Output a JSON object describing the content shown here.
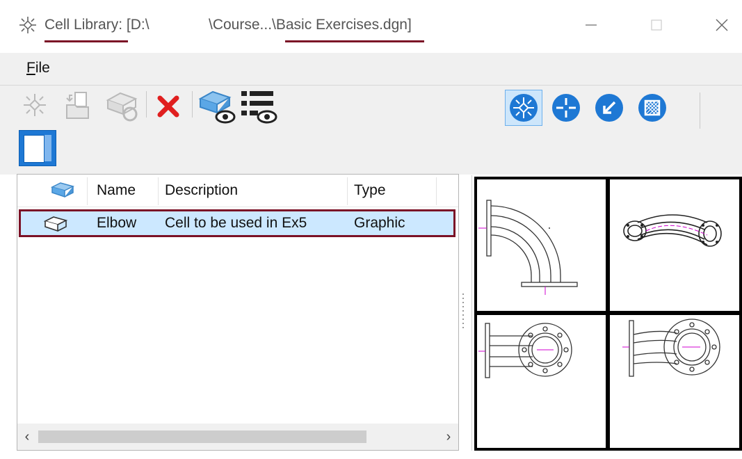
{
  "window": {
    "title_part1": "Cell Library: [D:\\",
    "title_part2": "\\Course...\\Basic Exercises.dgn]",
    "app_icon": "cell-library-icon",
    "controls": {
      "minimize": "minimize-icon",
      "maximize": "maximize-icon",
      "close": "close-icon"
    }
  },
  "menu": {
    "file_label_underlined": "F",
    "file_label_rest": "ile"
  },
  "toolbar": {
    "left_tools": [
      "create-cell-icon",
      "import-cell-icon",
      "update-library-icon",
      "delete-cell-icon",
      "preview-cell-icon",
      "list-view-icon"
    ],
    "right_tools": [
      "placement-mode-icon",
      "origin-icon",
      "point-icon",
      "pattern-icon"
    ],
    "active_tool": "placement-mode-icon",
    "panel_toggle": "preview-panel-toggle-icon"
  },
  "list": {
    "columns": [
      "Name",
      "Description",
      "Type"
    ],
    "rows": [
      {
        "name": "Elbow",
        "description": "Cell to be used in Ex5",
        "type": "Graphic",
        "selected": true
      }
    ]
  },
  "preview": {
    "views": [
      "top-view",
      "isometric-view",
      "front-view",
      "right-view"
    ]
  },
  "colors": {
    "accent": "#1e78d4",
    "selection_bg": "#cce8ff",
    "highlight_border": "#7b1126"
  }
}
